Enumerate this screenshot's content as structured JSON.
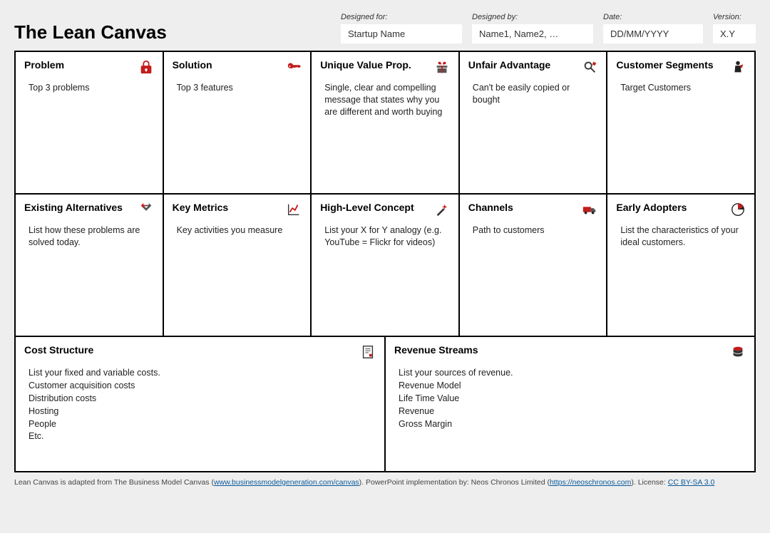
{
  "title": "The Lean Canvas",
  "meta": {
    "designed_for_label": "Designed for:",
    "designed_for_value": "Startup Name",
    "designed_by_label": "Designed by:",
    "designed_by_value": "Name1, Name2, …",
    "date_label": "Date:",
    "date_value": "DD/MM/YYYY",
    "version_label": "Version:",
    "version_value": "X.Y"
  },
  "cells": {
    "problem": {
      "title": "Problem",
      "body": "Top 3 problems"
    },
    "solution": {
      "title": "Solution",
      "body": "Top 3 features"
    },
    "uvp": {
      "title": "Unique Value Prop.",
      "body": "Single, clear and compelling message that states why you are different and worth buying"
    },
    "unfair": {
      "title": "Unfair Advantage",
      "body": "Can't be easily copied or bought"
    },
    "segments": {
      "title": "Customer Segments",
      "body": "Target Customers"
    },
    "alternatives": {
      "title": "Existing Alternatives",
      "body": "List how these problems are solved today."
    },
    "metrics": {
      "title": "Key Metrics",
      "body": "Key activities you measure"
    },
    "concept": {
      "title": "High-Level Concept",
      "body": "List your X for Y analogy (e.g. YouTube = Flickr for videos)"
    },
    "channels": {
      "title": "Channels",
      "body": "Path to customers"
    },
    "adopters": {
      "title": "Early Adopters",
      "body": "List the characteristics of your ideal customers."
    },
    "cost": {
      "title": "Cost Structure",
      "lines": [
        "List your fixed and variable costs.",
        "Customer acquisition costs",
        "Distribution costs",
        "Hosting",
        "People",
        "Etc."
      ]
    },
    "revenue": {
      "title": "Revenue Streams",
      "lines": [
        "List your sources of revenue.",
        "Revenue Model",
        "Life Time Value",
        "Revenue",
        "Gross Margin"
      ]
    }
  },
  "footer": {
    "text1": "Lean Canvas is adapted from The Business Model Canvas (",
    "link1": "www.businessmodelgeneration.com/canvas",
    "text2": "). PowerPoint implementation by: Neos Chronos Limited (",
    "link2": "https://neoschronos.com",
    "text3": "). License: ",
    "link3": "CC BY-SA 3.0"
  }
}
